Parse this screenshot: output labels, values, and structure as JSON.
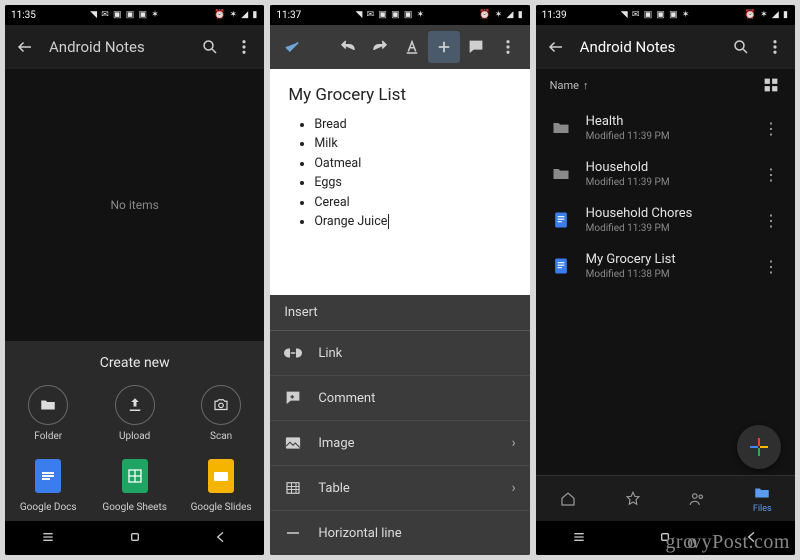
{
  "watermark": "groovyPost.com",
  "screen1": {
    "time": "11:35",
    "title": "Android Notes",
    "empty_text": "No items",
    "sheet_title": "Create new",
    "items": [
      {
        "label": "Folder"
      },
      {
        "label": "Upload"
      },
      {
        "label": "Scan"
      },
      {
        "label": "Google Docs",
        "color": "#3b7ded"
      },
      {
        "label": "Google Sheets",
        "color": "#1fa463"
      },
      {
        "label": "Google Slides",
        "color": "#f4b400"
      }
    ]
  },
  "screen2": {
    "time": "11:37",
    "doc_title": "My Grocery List",
    "items": [
      "Bread",
      "Milk",
      "Oatmeal",
      "Eggs",
      "Cereal",
      "Orange Juice"
    ],
    "insert_header": "Insert",
    "insert_items": [
      {
        "label": "Link",
        "icon": "link",
        "chev": false
      },
      {
        "label": "Comment",
        "icon": "comment",
        "chev": false
      },
      {
        "label": "Image",
        "icon": "image",
        "chev": true
      },
      {
        "label": "Table",
        "icon": "table",
        "chev": true
      },
      {
        "label": "Horizontal line",
        "icon": "hr",
        "chev": false
      }
    ]
  },
  "screen3": {
    "time": "11:39",
    "title": "Android Notes",
    "sort_label": "Name",
    "files": [
      {
        "name": "Health",
        "modified": "Modified 11:39 PM",
        "type": "folder"
      },
      {
        "name": "Household",
        "modified": "Modified 11:39 PM",
        "type": "folder"
      },
      {
        "name": "Household Chores",
        "modified": "Modified 11:39 PM",
        "type": "doc"
      },
      {
        "name": "My Grocery List",
        "modified": "Modified 11:38 PM",
        "type": "doc"
      }
    ],
    "bottom_nav": [
      {
        "label": "",
        "icon": "home"
      },
      {
        "label": "",
        "icon": "star"
      },
      {
        "label": "",
        "icon": "shared"
      },
      {
        "label": "Files",
        "icon": "folder",
        "active": true
      }
    ]
  }
}
